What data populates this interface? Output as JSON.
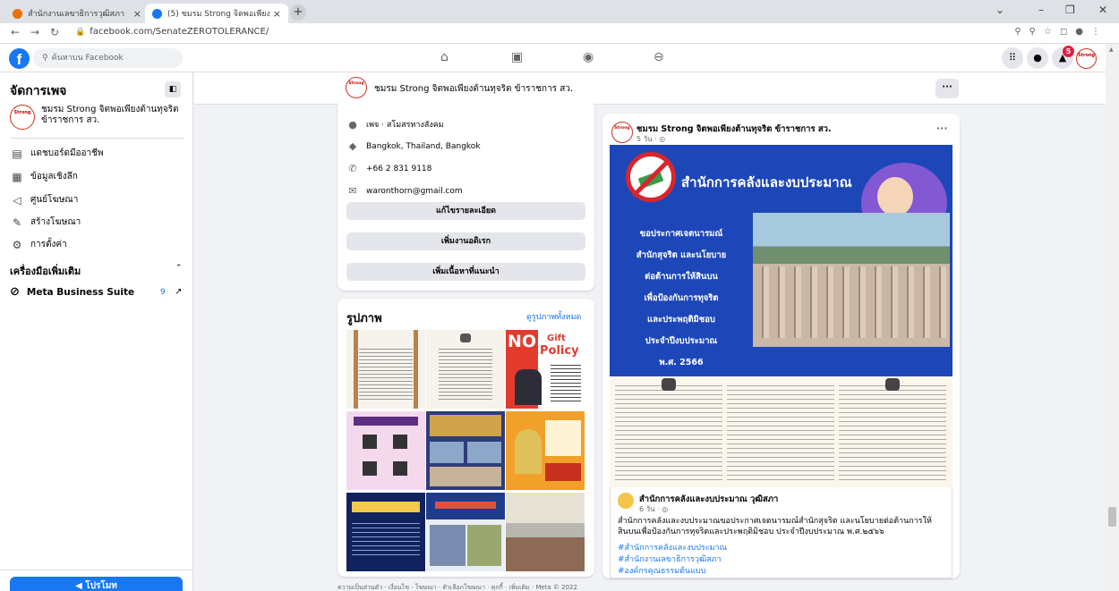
{
  "browser": {
    "tabs": [
      {
        "title": "สำนักงานเลขาธิการวุฒิสภา",
        "close": "×"
      },
      {
        "title": "(5) ชมรม Strong จิตพอเพียงต้านทุจริ",
        "close": "×"
      }
    ],
    "new_tab": "+",
    "url": "facebook.com/SenateZEROTOLERANCE/",
    "window_controls": [
      "⌄",
      "–",
      "❐",
      "✕"
    ]
  },
  "fb": {
    "logo": "f",
    "search_placeholder": "ค้นหาบน Facebook",
    "notification_count": "5",
    "avatar_text": "Strong"
  },
  "sidebar": {
    "title": "จัดการเพจ",
    "page_name": "ชมรม Strong จิตพอเพียงต้านทุจริต ข้าราชการ สว.",
    "items": [
      {
        "label": "แดชบอร์ดมืออาชีพ",
        "icon": "dashboard-icon"
      },
      {
        "label": "ข้อมูลเชิงลึก",
        "icon": "insights-icon"
      },
      {
        "label": "ศูนย์โฆษณา",
        "icon": "megaphone-icon"
      },
      {
        "label": "สร้างโฆษณา",
        "icon": "edit-icon"
      },
      {
        "label": "การตั้งค่า",
        "icon": "gear-icon"
      }
    ],
    "section_title": "เครื่องมือเพิ่มเติม",
    "mbs_label": "Meta Business Suite",
    "mbs_count": "9",
    "promote_label": "โปรโมท"
  },
  "page_header": {
    "name": "ชมรม Strong จิตพอเพียงต้านทุจริต ข้าราชการ สว.",
    "more": "···"
  },
  "about": {
    "category": "เพจ · สโมสรทางสังคม",
    "location": "Bangkok, Thailand, Bangkok",
    "phone": "+66 2 831 9118",
    "email": "waronthorn@gmail.com",
    "buttons": [
      "แก้ไขรายละเอียด",
      "เพิ่มงานอดิเรก",
      "เพิ่มเนื้อหาที่แนะนำ"
    ]
  },
  "photos": {
    "title": "รูปภาพ",
    "see_all": "ดูรูปภาพทั้งหมด",
    "gift_policy": {
      "no": "NO",
      "gift": "Gift",
      "policy": "Policy"
    }
  },
  "post": {
    "author": "ชมรม Strong จิตพอเพียงต้านทุจริต ข้าราชการ สว.",
    "meta": "5 วัน · ◎",
    "banner_title": "สำนักการคลังและงบประมาณ",
    "banner_lines": [
      "ขอประกาศเจตนารมณ์",
      "สำนักสุจริต และนโยบาย",
      "ต่อต้านการให้สินบน",
      "เพื่อป้องกันการทุจริต",
      "และประพฤติมิชอบ",
      "ประจำปีงบประมาณ",
      "พ.ศ. 2566"
    ],
    "shared_name": "สำนักการคลังและงบประมาณ วุฒิสภา",
    "shared_meta": "6 วัน · ◎",
    "shared_body": "สำนักการคลังและงบประมาณขอประกาศเจตนารมณ์สำนักสุจริต และนโยบายต่อต้านการให้สินบนเพื่อป้องกันการทุจริตและประพฤติมิชอบ ประจำปีงบประมาณ พ.ศ.๒๕๖๖",
    "hashtags": [
      "#สำนักการคลังและงบประมาณ",
      "#สำนักงานเลขาธิการวุฒิสภา",
      "#องค์กรคุณธรรมต้นแบบ"
    ]
  },
  "footer": "ความเป็นส่วนตัว · เงื่อนไข · โฆษณา · ตัวเลือกโฆษณา · คุกกี้ · เพิ่มเติม · Meta © 2022"
}
